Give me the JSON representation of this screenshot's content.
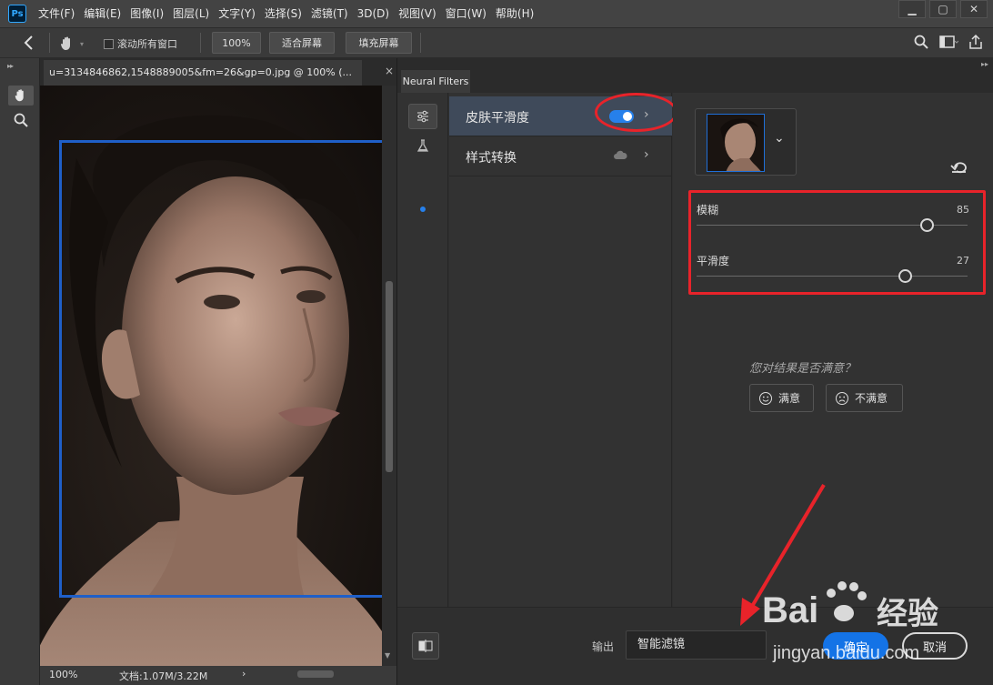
{
  "app": {
    "logo": "Ps"
  },
  "menu": [
    "文件(F)",
    "编辑(E)",
    "图像(I)",
    "图层(L)",
    "文字(Y)",
    "选择(S)",
    "滤镜(T)",
    "3D(D)",
    "视图(V)",
    "窗口(W)",
    "帮助(H)"
  ],
  "window_controls": {
    "minimize": "▁",
    "maximize": "▢",
    "close": "✕"
  },
  "options": {
    "scroll_all_label": "滚动所有窗口",
    "zoom_btn": "100%",
    "fit_btn": "适合屏幕",
    "fill_btn": "填充屏幕"
  },
  "document": {
    "tab_title": "u=3134846862,1548889005&fm=26&gp=0.jpg @ 100% (...",
    "close": "×",
    "status_zoom": "100%",
    "status_doc": "文档:1.07M/3.22M",
    "status_arrow": "›"
  },
  "neural_filters": {
    "tab_label": "Neural Filters",
    "filters": [
      {
        "label": "皮肤平滑度",
        "enabled": true,
        "selected": true
      },
      {
        "label": "样式转换",
        "enabled": false,
        "selected": false
      }
    ],
    "sliders": [
      {
        "label": "模糊",
        "value": 85,
        "min": 0,
        "max": 100
      },
      {
        "label": "平滑度",
        "value": 27,
        "min": -50,
        "max": 50
      }
    ],
    "feedback_question": "您对结果是否满意？",
    "satisfied": "满意",
    "unsatisfied": "不满意",
    "output_label": "输出",
    "output_value": "智能滤镜",
    "ok": "确定",
    "cancel": "取消",
    "accent_color": "#2680eb",
    "highlight_color": "#e8232a"
  },
  "watermark": {
    "brand": "Bai",
    "brand_cn": "经验",
    "url": "jingyan.baidu.com"
  }
}
